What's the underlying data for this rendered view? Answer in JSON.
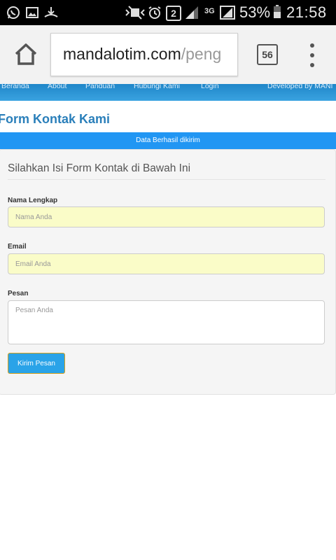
{
  "status_bar": {
    "icons": [
      "whatsapp-icon",
      "gallery-icon",
      "download-icon",
      "mute-icon",
      "alarm-icon",
      "sim2-icon",
      "signal-icon",
      "3g-icon",
      "signal-icon-2",
      "battery-icon"
    ],
    "sim_label": "2",
    "network_label": "3G",
    "battery": "53%",
    "time": "21:58"
  },
  "browser": {
    "url_host": "mandalotim.com",
    "url_path": "/peng",
    "tab_count": "56"
  },
  "nav": {
    "items": [
      "Beranda",
      "About",
      "Panduan",
      "Hubungi Kami",
      "Login"
    ],
    "developer": "Developed by MANI"
  },
  "page": {
    "title": "Form Kontak Kami",
    "alert": "Data Berhasil dikirim"
  },
  "form": {
    "legend": "Silahkan Isi Form Kontak di Bawah Ini",
    "name_label": "Nama Lengkap",
    "name_placeholder": "Nama Anda",
    "email_label": "Email",
    "email_placeholder": "Email Anda",
    "message_label": "Pesan",
    "message_placeholder": "Pesan Anda",
    "submit_label": "Kirim Pesan"
  },
  "colors": {
    "navbar": "#2b95d6",
    "alert": "#2196f3",
    "title": "#2a7fba",
    "input_bg": "#fafcc8"
  }
}
